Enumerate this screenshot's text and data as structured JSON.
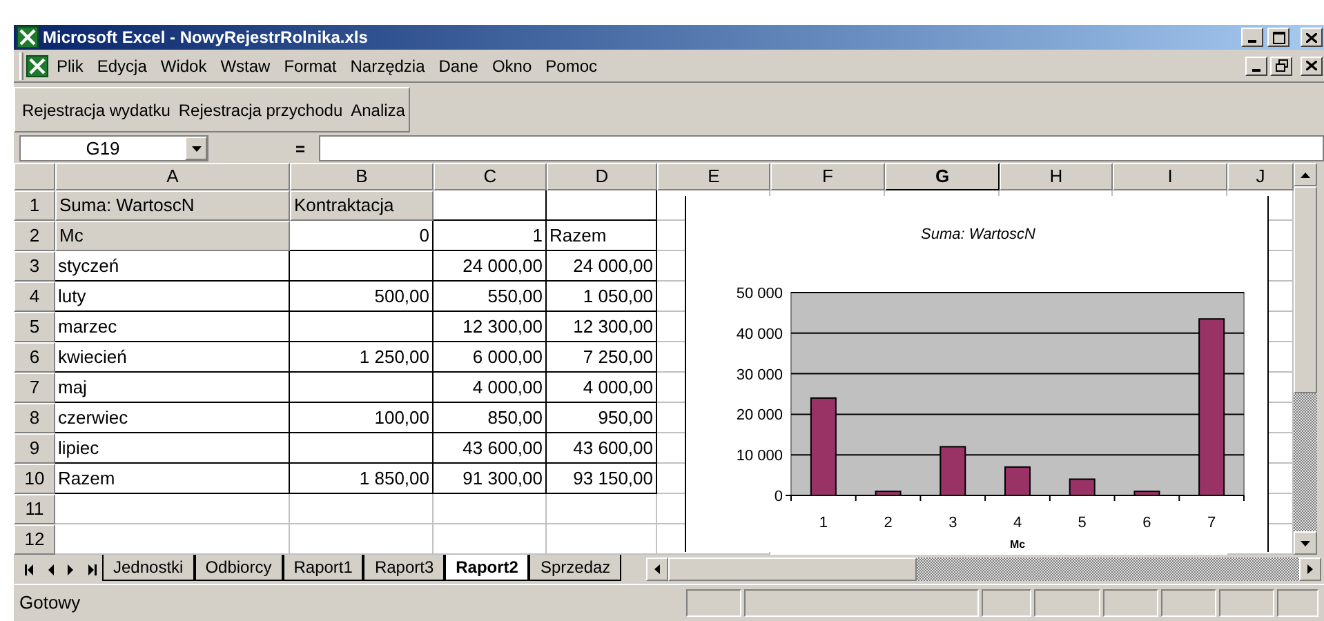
{
  "window": {
    "title": "Microsoft Excel - NowyRejestrRolnika.xls"
  },
  "menu": [
    "Plik",
    "Edycja",
    "Widok",
    "Wstaw",
    "Format",
    "Narzędzia",
    "Dane",
    "Okno",
    "Pomoc"
  ],
  "toolbar": [
    "Rejestracja wydatku",
    "Rejestracja przychodu",
    "Analiza"
  ],
  "formula_bar": {
    "name_box": "G19",
    "equals": "="
  },
  "columns": [
    {
      "label": "A",
      "selected": false
    },
    {
      "label": "B",
      "selected": false
    },
    {
      "label": "C",
      "selected": false
    },
    {
      "label": "D",
      "selected": false
    },
    {
      "label": "E",
      "selected": false
    },
    {
      "label": "F",
      "selected": false
    },
    {
      "label": "G",
      "selected": true
    },
    {
      "label": "H",
      "selected": false
    },
    {
      "label": "I",
      "selected": false
    },
    {
      "label": "J",
      "selected": false
    }
  ],
  "rows": [
    {
      "number": "1",
      "cells": {
        "A": {
          "text": "Suma: WartoscN",
          "kind": "field"
        },
        "B": {
          "text": "Kontraktacja",
          "kind": "field"
        }
      }
    },
    {
      "number": "2",
      "cells": {
        "A": {
          "text": "Mc",
          "kind": "field"
        },
        "B": {
          "text": "0",
          "kind": "number"
        },
        "C": {
          "text": "1",
          "kind": "number"
        },
        "D": {
          "text": "Razem",
          "kind": "text"
        }
      }
    },
    {
      "number": "3",
      "cells": {
        "A": {
          "text": "styczeń",
          "kind": "text"
        },
        "C": {
          "text": "24 000,00",
          "kind": "number"
        },
        "D": {
          "text": "24 000,00",
          "kind": "number"
        }
      }
    },
    {
      "number": "4",
      "cells": {
        "A": {
          "text": "luty",
          "kind": "text"
        },
        "B": {
          "text": "500,00",
          "kind": "number"
        },
        "C": {
          "text": "550,00",
          "kind": "number"
        },
        "D": {
          "text": "1 050,00",
          "kind": "number"
        }
      }
    },
    {
      "number": "5",
      "cells": {
        "A": {
          "text": "marzec",
          "kind": "text"
        },
        "C": {
          "text": "12 300,00",
          "kind": "number"
        },
        "D": {
          "text": "12 300,00",
          "kind": "number"
        }
      }
    },
    {
      "number": "6",
      "cells": {
        "A": {
          "text": "kwiecień",
          "kind": "text"
        },
        "B": {
          "text": "1 250,00",
          "kind": "number"
        },
        "C": {
          "text": "6 000,00",
          "kind": "number"
        },
        "D": {
          "text": "7 250,00",
          "kind": "number"
        }
      }
    },
    {
      "number": "7",
      "cells": {
        "A": {
          "text": "maj",
          "kind": "text"
        },
        "C": {
          "text": "4 000,00",
          "kind": "number"
        },
        "D": {
          "text": "4 000,00",
          "kind": "number"
        }
      }
    },
    {
      "number": "8",
      "cells": {
        "A": {
          "text": "czerwiec",
          "kind": "text"
        },
        "B": {
          "text": "100,00",
          "kind": "number"
        },
        "C": {
          "text": "850,00",
          "kind": "number"
        },
        "D": {
          "text": "950,00",
          "kind": "number"
        }
      }
    },
    {
      "number": "9",
      "cells": {
        "A": {
          "text": "lipiec",
          "kind": "text"
        },
        "C": {
          "text": "43 600,00",
          "kind": "number"
        },
        "D": {
          "text": "43 600,00",
          "kind": "number"
        }
      }
    },
    {
      "number": "10",
      "cells": {
        "A": {
          "text": "Razem",
          "kind": "text"
        },
        "B": {
          "text": "1 850,00",
          "kind": "number"
        },
        "C": {
          "text": "91 300,00",
          "kind": "number"
        },
        "D": {
          "text": "93 150,00",
          "kind": "number"
        }
      }
    },
    {
      "number": "11",
      "cells": {}
    },
    {
      "number": "12",
      "cells": {}
    }
  ],
  "chart": {
    "chart_data": {
      "type": "bar",
      "title": "Suma: WartoscN",
      "xlabel": "Mc",
      "categories": [
        "1",
        "2",
        "3",
        "4",
        "5",
        "6",
        "7"
      ],
      "series": [
        {
          "color": "#993366",
          "values": [
            24000,
            1000,
            12000,
            7000,
            4000,
            1000,
            43500
          ]
        }
      ],
      "grid": true,
      "ylim": [
        0,
        50000
      ],
      "yticks": [
        {
          "value": 0,
          "label": "0"
        },
        {
          "value": 10000,
          "label": "10 000"
        },
        {
          "value": 20000,
          "label": "20 000"
        },
        {
          "value": 30000,
          "label": "30 000"
        },
        {
          "value": 40000,
          "label": "40 000"
        },
        {
          "value": 50000,
          "label": "50 000"
        }
      ]
    }
  },
  "sheet_tabs": [
    {
      "label": "Jednostki",
      "selected": false
    },
    {
      "label": "Odbiorcy",
      "selected": false
    },
    {
      "label": "Raport1",
      "selected": false
    },
    {
      "label": "Raport3",
      "selected": false
    },
    {
      "label": "Raport2",
      "selected": true
    },
    {
      "label": "Sprzedaz",
      "selected": false
    }
  ],
  "status_bar": {
    "text": "Gotowy"
  }
}
